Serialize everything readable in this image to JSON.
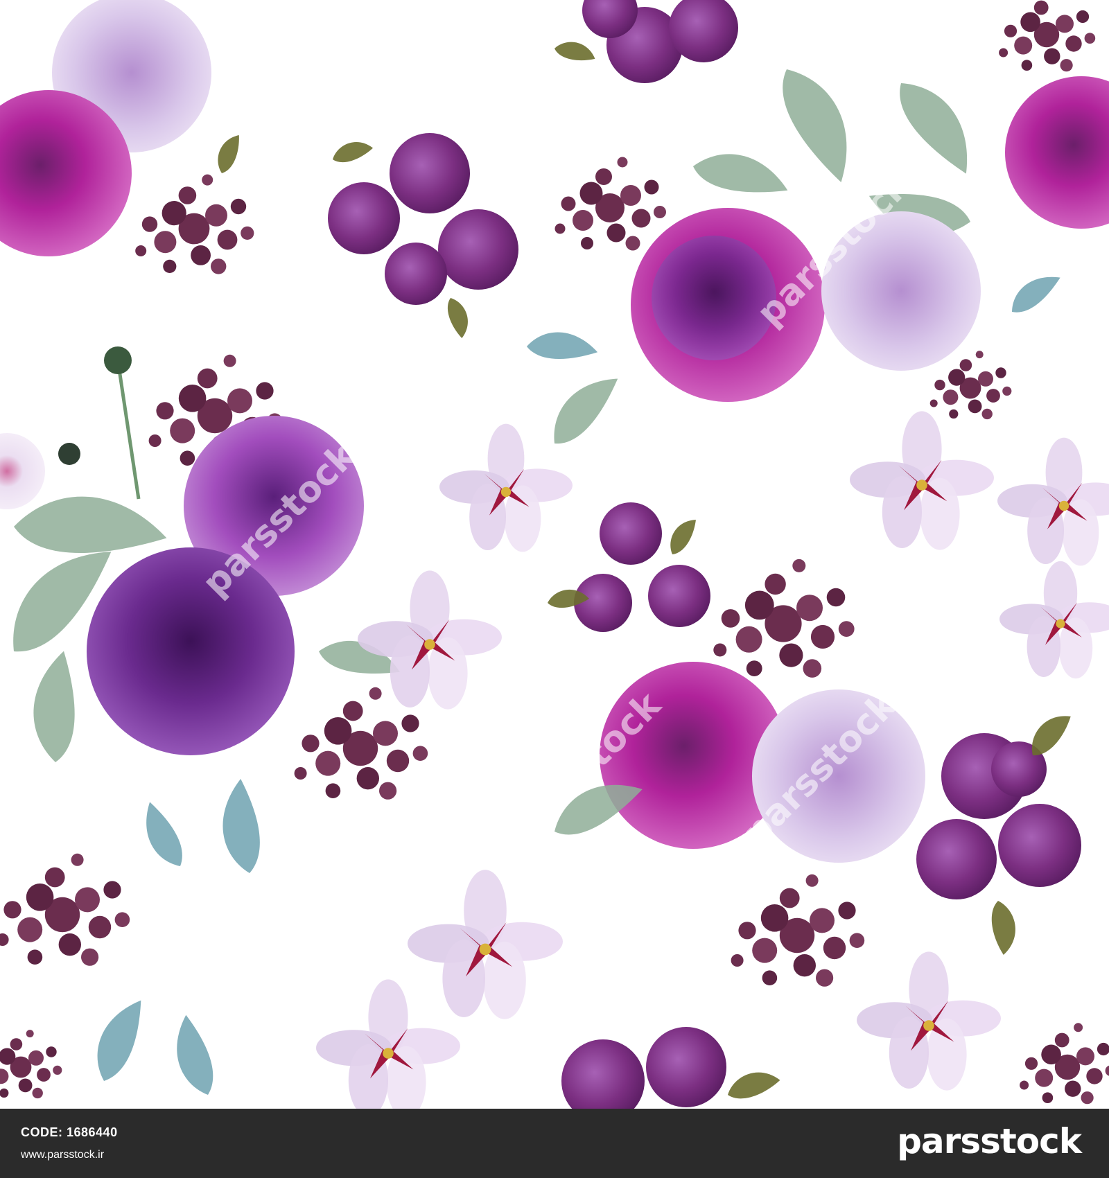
{
  "footer": {
    "code": "CODE: 1686440",
    "site": "www.parsstock.ir",
    "brand": "parsstock"
  },
  "watermark": {
    "text": "parsstock"
  },
  "palette": {
    "magenta": "#b0229a",
    "deep_purple": "#6a2a8e",
    "violet": "#8a3fb0",
    "lavender": "#d9c7ea",
    "plum": "#6b2d4e",
    "berry": "#7c2f82",
    "sage": "#8fae98",
    "olive": "#6b6e2e",
    "teal": "#6fa2b0",
    "blossom": "#e6d6ee",
    "crimson": "#a0183e"
  }
}
